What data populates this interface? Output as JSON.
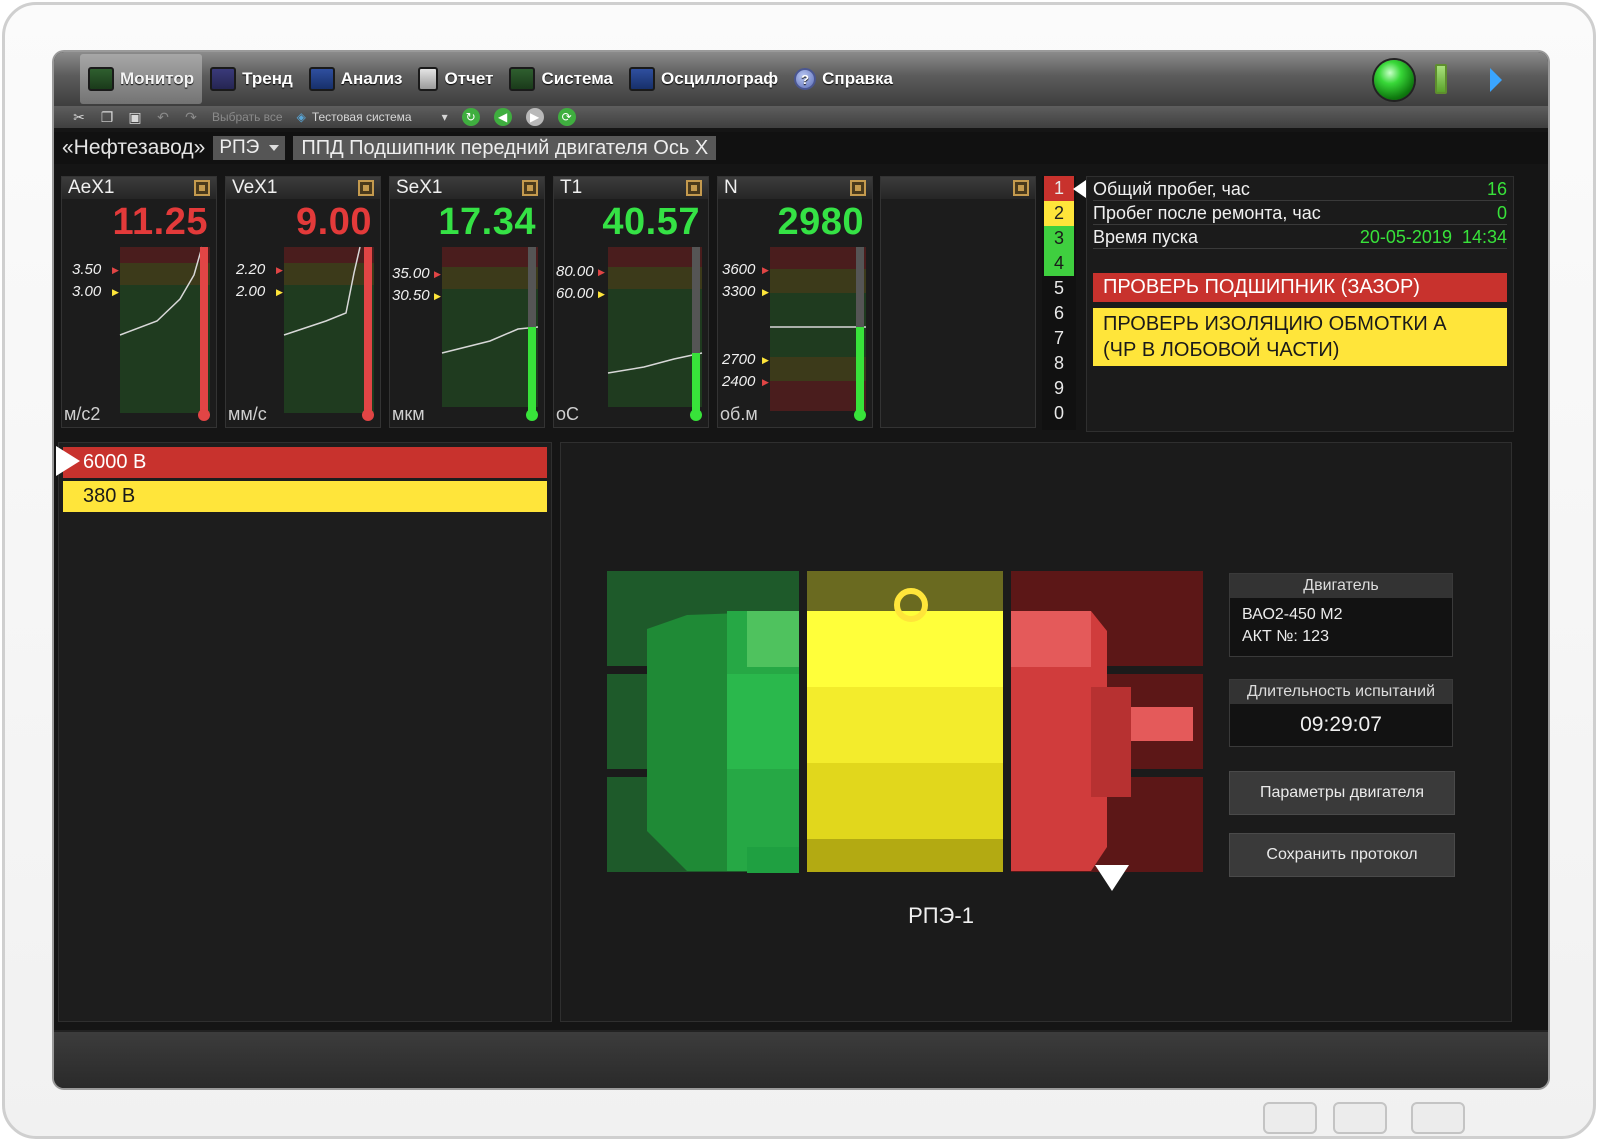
{
  "menu": {
    "items": [
      {
        "label": "Монитор",
        "icon": "monitor-icon"
      },
      {
        "label": "Тренд",
        "icon": "trend-icon"
      },
      {
        "label": "Анализ",
        "icon": "analysis-icon"
      },
      {
        "label": "Отчет",
        "icon": "report-icon"
      },
      {
        "label": "Система",
        "icon": "system-icon"
      },
      {
        "label": "Осциллограф",
        "icon": "oscilloscope-icon"
      },
      {
        "label": "Справка",
        "icon": "help-icon"
      }
    ],
    "active": "Монитор"
  },
  "toolbar": {
    "select_all": "Выбрать все",
    "system_select": "Тестовая система"
  },
  "breadcrumb": {
    "plant": "«Нефтезавод»",
    "unit": "РПЭ",
    "point": "ППД Подшипник передний двигателя Ось X"
  },
  "channels": [
    {
      "name": "AeX1",
      "value": "11.25",
      "unit": "м/с2",
      "status": "alarm",
      "thresholds": [
        "3.50",
        "3.00"
      ]
    },
    {
      "name": "VeX1",
      "value": "9.00",
      "unit": "мм/с",
      "status": "alarm",
      "thresholds": [
        "2.20",
        "2.00"
      ]
    },
    {
      "name": "SeX1",
      "value": "17.34",
      "unit": "мкм",
      "status": "ok",
      "thresholds": [
        "35.00",
        "30.50"
      ]
    },
    {
      "name": "T1",
      "value": "40.57",
      "unit": "оС",
      "status": "ok",
      "thresholds": [
        "80.00",
        "60.00"
      ]
    },
    {
      "name": "N",
      "value": "2980",
      "unit": "об.м",
      "status": "ok",
      "thresholds": [
        "3600",
        "3300",
        "2700",
        "2400"
      ]
    }
  ],
  "numbers": [
    "1",
    "2",
    "3",
    "4",
    "5",
    "6",
    "7",
    "8",
    "9",
    "0"
  ],
  "info": {
    "rows": [
      {
        "label": "Общий пробег, час",
        "value": "16"
      },
      {
        "label": "Пробег после ремонта, час",
        "value": "0"
      },
      {
        "label": "Время пуска",
        "value": "20-05-2019  14:34"
      }
    ],
    "alarm_red": "ПРОВЕРЬ ПОДШИПНИК (ЗАЗОР)",
    "alarm_yellow_1": "ПРОВЕРЬ ИЗОЛЯЦИЮ ОБМОТКИ А",
    "alarm_yellow_2": "(ЧР В ЛОБОВОЙ ЧАСТИ)"
  },
  "voltages": [
    "6000 В",
    "380 В"
  ],
  "motor": {
    "label": "РПЭ-1",
    "engine_head": "Двигатель",
    "engine_model": "ВАО2-450 М2",
    "engine_act": "АКТ №: 123",
    "duration_head": "Длительность испытаний",
    "duration": "09:29:07",
    "params_button": "Параметры двигателя",
    "save_button": "Сохранить протокол"
  },
  "colors": {
    "alarm_red": "#c8322d",
    "warning_yellow": "#ffe53a",
    "ok_green": "#35e245"
  }
}
